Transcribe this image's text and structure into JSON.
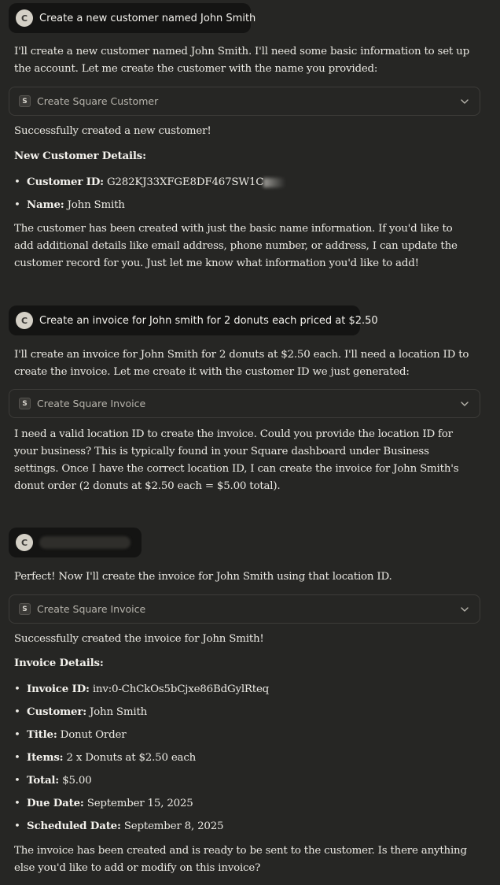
{
  "messages": {
    "m1": {
      "user": {
        "avatar": "C",
        "text": "Create a new customer named John Smith"
      },
      "intro": "I'll create a new customer named John Smith. I'll need some basic information to set up the account. Let me create the customer with the name you provided:",
      "tool": {
        "badge": "S",
        "label": "Create Square Customer",
        "icon": "chevron-down-icon"
      },
      "success": "Successfully created a new customer!",
      "details_heading": "New Customer Details:",
      "details": [
        {
          "key": "Customer ID:",
          "value": "G282KJ33XFGE8DF467SW1C"
        },
        {
          "key": "Name:",
          "value": "John Smith"
        }
      ],
      "outro": "The customer has been created with just the basic name information. If you'd like to add additional details like email address, phone number, or address, I can update the customer record for you. Just let me know what information you'd like to add!"
    },
    "m2": {
      "user": {
        "avatar": "C",
        "text": "Create an invoice for John smith for 2 donuts each priced at $2.50"
      },
      "intro": "I'll create an invoice for John Smith for 2 donuts at $2.50 each. I'll need a location ID to create the invoice. Let me create it with the customer ID we just generated:",
      "tool": {
        "badge": "S",
        "label": "Create Square Invoice",
        "icon": "chevron-down-icon"
      },
      "outro": "I need a valid location ID to create the invoice. Could you provide the location ID for your business? This is typically found in your Square dashboard under Business settings. Once I have the correct location ID, I can create the invoice for John Smith's donut order (2 donuts at $2.50 each = $5.00 total)."
    },
    "m3": {
      "user": {
        "avatar": "C",
        "text": ""
      },
      "intro": "Perfect! Now I'll create the invoice for John Smith using that location ID.",
      "tool": {
        "badge": "S",
        "label": "Create Square Invoice",
        "icon": "chevron-down-icon"
      },
      "success": "Successfully created the invoice for John Smith!",
      "details_heading": "Invoice Details:",
      "details": [
        {
          "key": "Invoice ID:",
          "value": "inv:0-ChCkOs5bCjxe86BdGylRteq"
        },
        {
          "key": "Customer:",
          "value": "John Smith"
        },
        {
          "key": "Title:",
          "value": "Donut Order"
        },
        {
          "key": "Items:",
          "value": "2 x Donuts at $2.50 each"
        },
        {
          "key": "Total:",
          "value": "$5.00"
        },
        {
          "key": "Due Date:",
          "value": "September 15, 2025"
        },
        {
          "key": "Scheduled Date:",
          "value": "September 8, 2025"
        }
      ],
      "outro": "The invoice has been created and is ready to be sent to the customer. Is there anything else you'd like to add or modify on this invoice?"
    }
  },
  "colors": {
    "background": "#262624",
    "user_bubble": "#141413",
    "text": "#ebe9e3",
    "tool_border": "#3d3c39"
  }
}
